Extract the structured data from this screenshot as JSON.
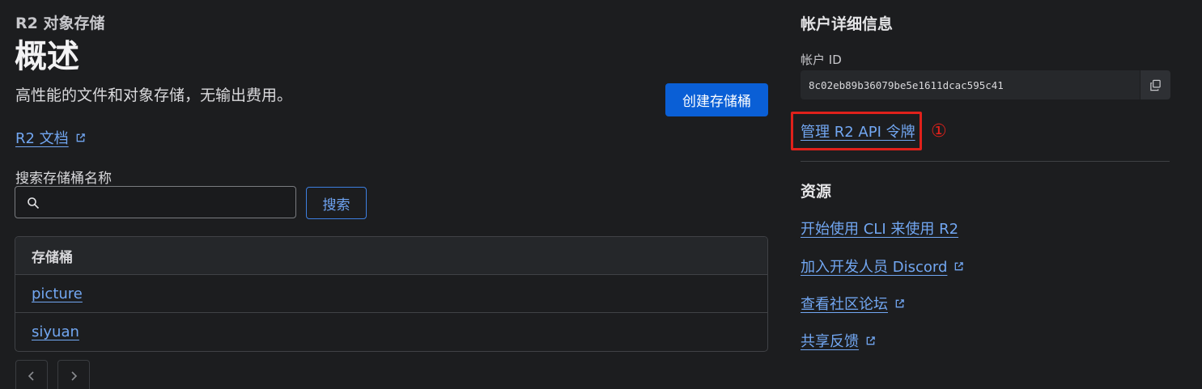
{
  "header": {
    "breadcrumb": "R2 对象存储",
    "title": "概述",
    "subtitle": "高性能的文件和对象存储，无输出费用。",
    "create_button": "创建存储桶",
    "doc_link": "R2 文档"
  },
  "search": {
    "label": "搜索存储桶名称",
    "value": "",
    "placeholder": "",
    "button": "搜索"
  },
  "table": {
    "header": "存储桶",
    "rows": [
      "picture",
      "siyuan"
    ]
  },
  "pagination": {
    "prev_icon": "chevron-left-icon",
    "next_icon": "chevron-right-icon"
  },
  "account": {
    "heading": "帐户详细信息",
    "id_label": "帐户 ID",
    "id_value": "8c02eb89b36079be5e1611dcac595c41",
    "manage_tokens_link": "管理 R2 API 令牌",
    "annotation_marker": "①"
  },
  "resources": {
    "heading": "资源",
    "links": [
      {
        "label": "开始使用 CLI 来使用 R2",
        "external": false
      },
      {
        "label": "加入开发人员 Discord",
        "external": true
      },
      {
        "label": "查看社区论坛",
        "external": true
      },
      {
        "label": "共享反馈",
        "external": true
      }
    ]
  },
  "colors": {
    "background": "#1c1d1f",
    "primary_button": "#0a5fd6",
    "link": "#72a7f2",
    "annotation_red": "#e0211b"
  }
}
